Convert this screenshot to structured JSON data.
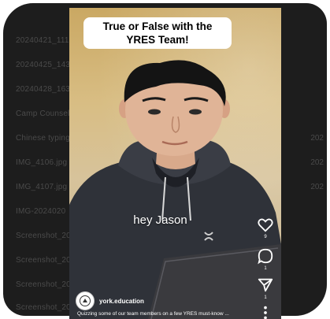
{
  "backdrop": {
    "files": [
      "20240421_11103",
      "20240425_14356",
      "20240428_16381",
      "Camp Counselo",
      "Chinese typing",
      "IMG_4106.jpg",
      "IMG_4107.jpg",
      "IMG-2024020",
      "Screenshot_202",
      "Screenshot_202",
      "Screenshot_202",
      "Screenshot_202"
    ],
    "right_fragments": [
      "202",
      "202",
      "202"
    ]
  },
  "reel": {
    "title": "True or False with the YRES Team!",
    "caption": "hey Jason",
    "account_handle": "york.education",
    "description": "Quizzing some of our team members on a few YRES must-know ...",
    "action_counts": {
      "like": "9",
      "comment": "1",
      "share": "1"
    }
  },
  "colors": {
    "backdrop": "#1d1d1d",
    "wall": "#d8bd83",
    "hoodie": "#2e3138",
    "laptop": "#3a3a3e"
  },
  "icons": [
    "heart-icon",
    "comment-icon",
    "share-icon",
    "more-icon"
  ]
}
